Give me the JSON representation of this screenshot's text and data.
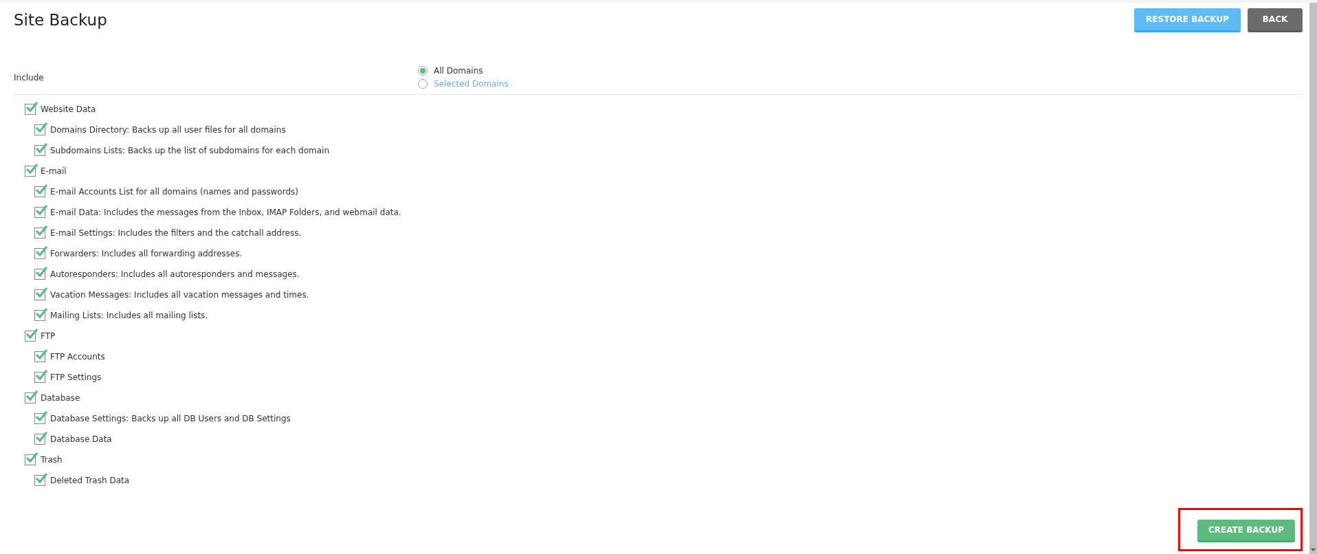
{
  "title": "Site Backup",
  "header_buttons": [
    {
      "label": "RESTORE BACKUP",
      "kind": "primary"
    },
    {
      "label": "BACK",
      "kind": "secondary"
    }
  ],
  "include": {
    "label": "Include",
    "options": [
      {
        "label": "All Domains",
        "selected": true
      },
      {
        "label": "Selected Domains",
        "selected": false
      }
    ]
  },
  "groups": [
    {
      "label": "Website Data",
      "checked": true,
      "children": [
        {
          "label": "Domains Directory: Backs up all user files for all domains",
          "checked": true
        },
        {
          "label": "Subdomains Lists: Backs up the list of subdomains for each domain",
          "checked": true
        }
      ]
    },
    {
      "label": "E-mail",
      "checked": true,
      "children": [
        {
          "label": "E-mail Accounts List for all domains (names and passwords)",
          "checked": true
        },
        {
          "label": "E-mail Data: Includes the messages from the Inbox, IMAP Folders, and webmail data.",
          "checked": true
        },
        {
          "label": "E-mail Settings: Includes the filters and the catchall address.",
          "checked": true
        },
        {
          "label": "Forwarders: Includes all forwarding addresses.",
          "checked": true
        },
        {
          "label": "Autoresponders: Includes all autoresponders and messages.",
          "checked": true
        },
        {
          "label": "Vacation Messages: Includes all vacation messages and times.",
          "checked": true
        },
        {
          "label": "Mailing Lists: Includes all mailing lists.",
          "checked": true
        }
      ]
    },
    {
      "label": "FTP",
      "checked": true,
      "children": [
        {
          "label": "FTP Accounts",
          "checked": true
        },
        {
          "label": "FTP Settings",
          "checked": true
        }
      ]
    },
    {
      "label": "Database",
      "checked": true,
      "children": [
        {
          "label": "Database Settings: Backs up all DB Users and DB Settings",
          "checked": true
        },
        {
          "label": "Database Data",
          "checked": true
        }
      ]
    },
    {
      "label": "Trash",
      "checked": true,
      "children": [
        {
          "label": "Deleted Trash Data",
          "checked": true
        }
      ]
    }
  ],
  "create_button": {
    "label": "CREATE BACKUP"
  }
}
